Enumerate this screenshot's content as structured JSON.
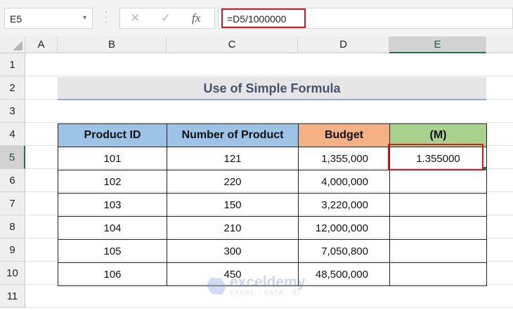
{
  "name_box": "E5",
  "formula_bar": {
    "cancel": "✕",
    "enter": "✓",
    "fx": "fx",
    "formula": "=D5/1000000"
  },
  "columns": [
    "A",
    "B",
    "C",
    "D",
    "E"
  ],
  "rows": [
    "1",
    "2",
    "3",
    "4",
    "5",
    "6",
    "7",
    "8",
    "9",
    "10",
    "11"
  ],
  "title": "Use of Simple Formula",
  "table": {
    "headers": [
      "Product ID",
      "Number of Product",
      "Budget",
      "(M)"
    ],
    "header_colors": [
      "#9dc3e6",
      "#9dc3e6",
      "#f4b183",
      "#a9d18e"
    ],
    "rows": [
      [
        "101",
        "121",
        "1,355,000",
        "1.355000"
      ],
      [
        "102",
        "220",
        "4,000,000",
        ""
      ],
      [
        "103",
        "150",
        "3,220,000",
        ""
      ],
      [
        "104",
        "210",
        "12,000,000",
        ""
      ],
      [
        "105",
        "300",
        "7,050,800",
        ""
      ],
      [
        "106",
        "450",
        "48,500,000",
        ""
      ]
    ]
  },
  "watermark": {
    "name": "exceldemy",
    "tagline": "EXCEL · DATA · BI"
  }
}
